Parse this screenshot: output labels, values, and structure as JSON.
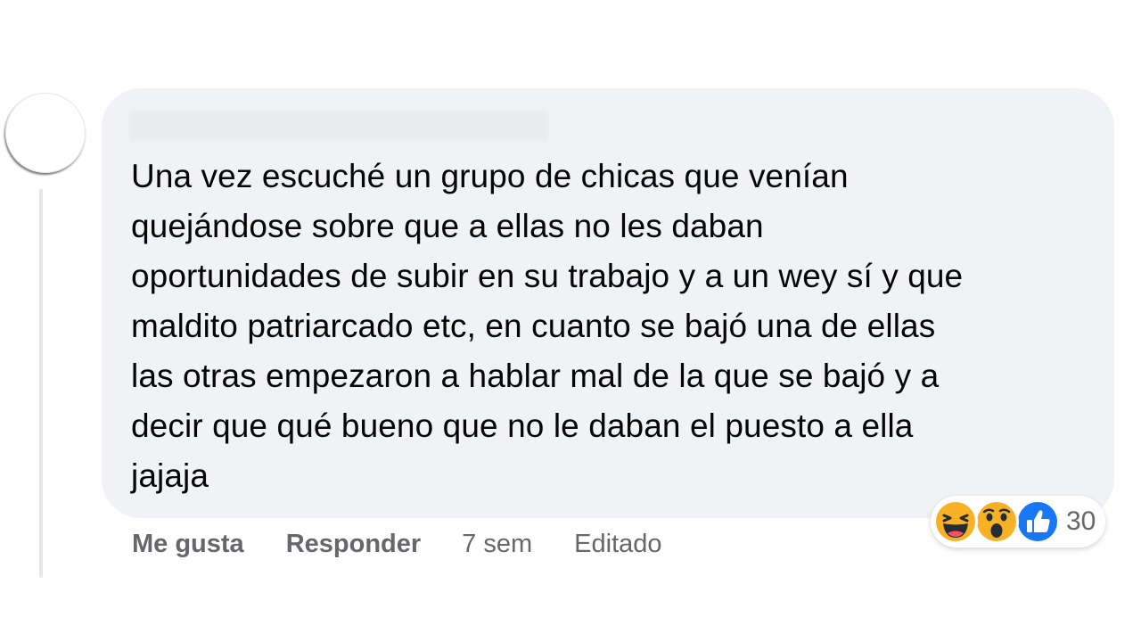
{
  "comment": {
    "author_name": "",
    "text_lines": [
      "Una vez escuché un grupo de chicas que venían",
      "quejándose sobre que a ellas no les daban",
      "oportunidades de subir en su trabajo y a un wey sí y que",
      "maldito patriarcado etc, en cuanto se bajó una de ellas",
      "las otras empezaron a hablar mal de la que se bajó y a",
      "decir que qué bueno que no le daban el puesto a ella",
      "jajaja"
    ]
  },
  "actions": {
    "like_label": "Me gusta",
    "reply_label": "Responder",
    "time_ago": "7 sem",
    "edited_label": "Editado"
  },
  "reactions": {
    "icons": [
      "haha-icon",
      "wow-icon",
      "like-icon"
    ],
    "count": "30"
  },
  "colors": {
    "bubble_bg": "#f0f2f5",
    "text": "#050505",
    "meta_text": "#65676b",
    "like_blue": "#1877f2",
    "emoji_yellow": "#f7b125"
  }
}
